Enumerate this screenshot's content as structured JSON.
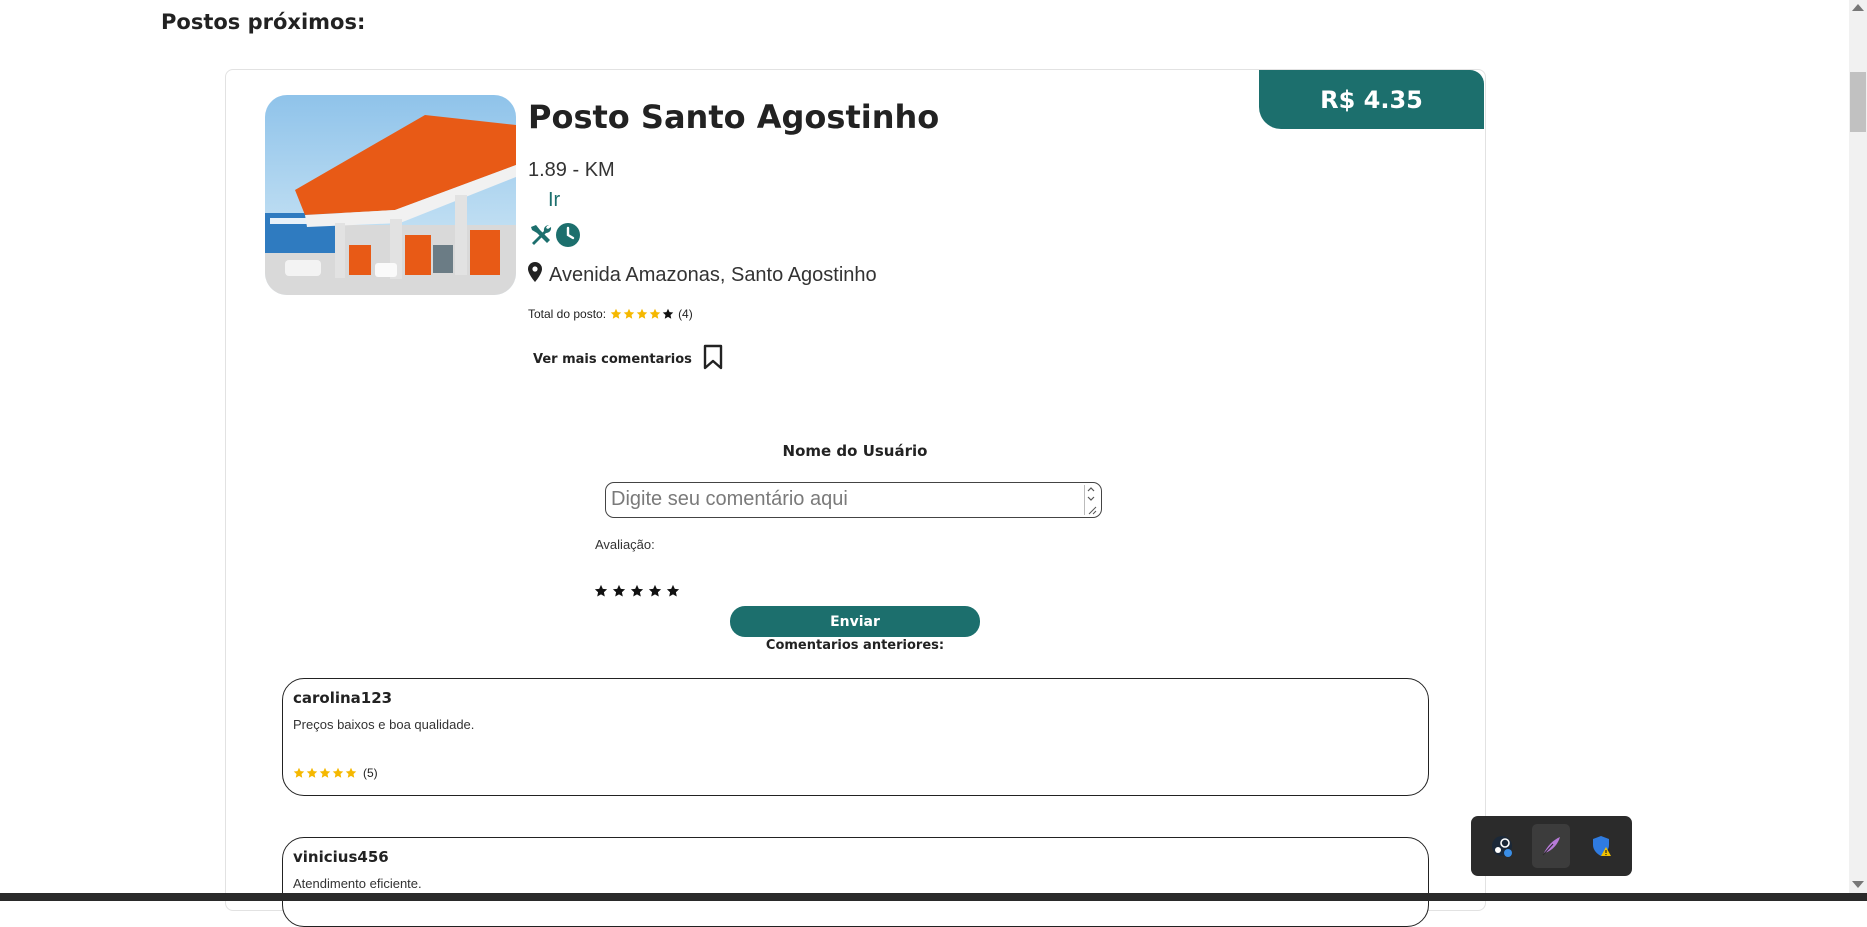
{
  "section": {
    "title": "Postos próximos:"
  },
  "station": {
    "price": "R$ 4.35",
    "name": "Posto Santo Agostinho",
    "distance": "1.89 - KM",
    "go_link": "Ir",
    "address": "Avenida Amazonas, Santo Agostinho",
    "rating_label": "Total do posto:",
    "rating_count": "(4)",
    "rating_value": 4,
    "more_comments": "Ver mais comentarios"
  },
  "comment_form": {
    "user_name": "Nome do Usuário",
    "placeholder": "Digite seu comentário aqui",
    "eval_label": "Avaliação:",
    "send_label": "Enviar",
    "previous_label": "Comentarios anteriores:"
  },
  "reviews": [
    {
      "author": "carolina123",
      "text": "Preços baixos e boa qualidade.",
      "rating_count": "(5)",
      "rating_value": 5
    },
    {
      "author": "vinicius456",
      "text": "Atendimento eficiente."
    }
  ],
  "colors": {
    "accent": "#1c6f6d",
    "star": "#f5b800"
  },
  "tray": {
    "icons": [
      "steam-icon",
      "feather-app-icon",
      "security-shield-warning-icon"
    ]
  }
}
